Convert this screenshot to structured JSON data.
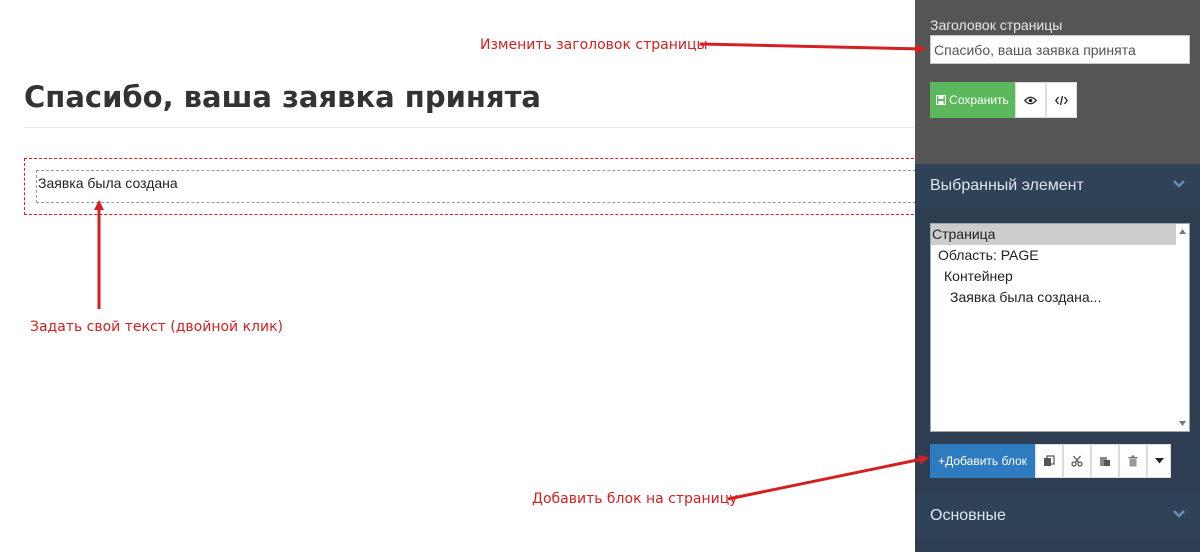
{
  "main": {
    "heading": "Спасибо, ваша заявка принята",
    "text_block": "Заявка была создана"
  },
  "annotations": {
    "change_title": "Изменить заголовок страницы",
    "set_text": "Задать свой текст (двойной клик)",
    "add_block": "Добавить блок на страницу"
  },
  "panel": {
    "title_label": "Заголовок страницы",
    "title_value": "Спасибо, ваша заявка принята",
    "save_label": "Сохранить",
    "selected_section": "Выбранный элемент",
    "tree": [
      "Страница",
      "Область: PAGE",
      "Контейнер",
      "Заявка была создана..."
    ],
    "add_block_label": "+Добавить блок",
    "basic_section": "Основные"
  },
  "icons": {
    "save": "floppy-disk-icon",
    "preview": "eye-icon",
    "code": "code-icon",
    "copy": "copy-icon",
    "cut": "scissors-icon",
    "paste": "paste-icon",
    "delete": "trash-icon",
    "dropdown": "caret-down-icon",
    "chevron": "chevron-down-icon"
  },
  "colors": {
    "annotation": "#d32020",
    "save_button": "#5cb85c",
    "add_button": "#2f7bbf",
    "panel_bg": "#2d3e52",
    "panel_top_bg": "#555555"
  }
}
